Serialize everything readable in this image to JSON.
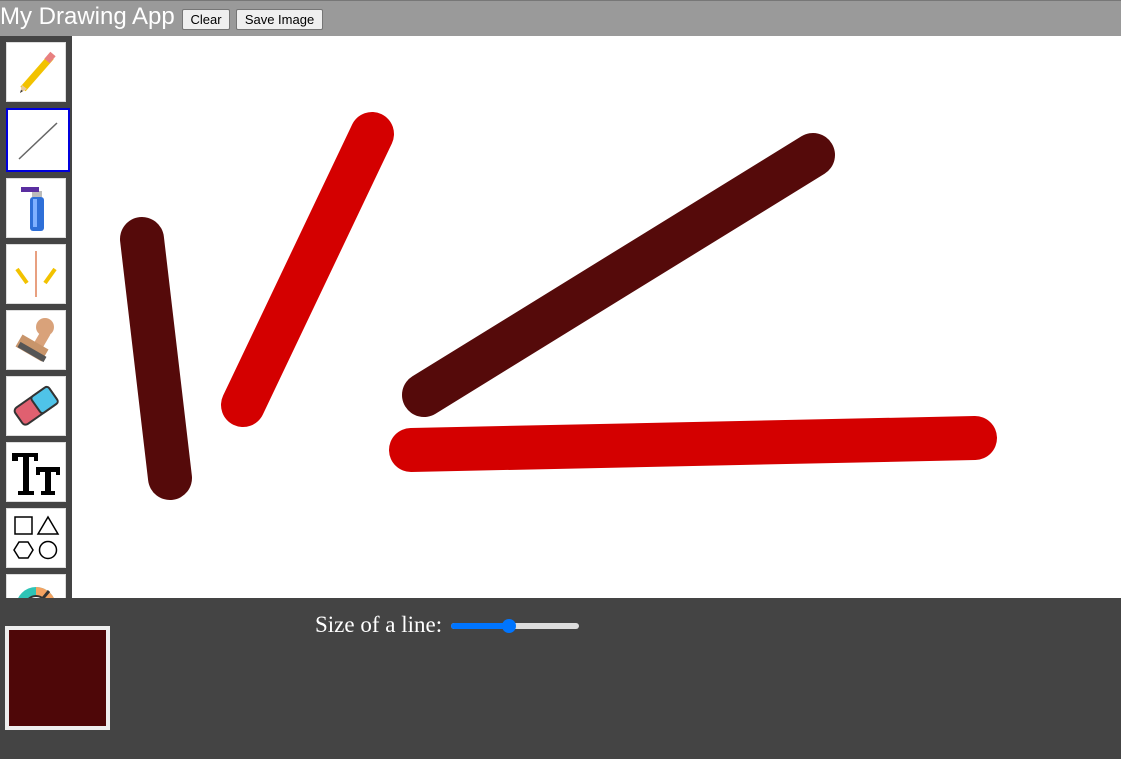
{
  "header": {
    "title": "My Drawing App",
    "clear_label": "Clear",
    "save_label": "Save Image"
  },
  "toolbar": {
    "tools": [
      {
        "name": "pencil",
        "icon": "pencil-icon",
        "active": false
      },
      {
        "name": "line",
        "icon": "line-icon",
        "active": true
      },
      {
        "name": "spray",
        "icon": "spray-can-icon",
        "active": false
      },
      {
        "name": "mirror",
        "icon": "mirror-pencils-icon",
        "active": false
      },
      {
        "name": "stamp",
        "icon": "stamp-icon",
        "active": false
      },
      {
        "name": "eraser",
        "icon": "eraser-icon",
        "active": false
      },
      {
        "name": "text",
        "icon": "text-icon",
        "active": false
      },
      {
        "name": "shapes",
        "icon": "shapes-icon",
        "active": false
      },
      {
        "name": "color-picker",
        "icon": "color-wheel-icon",
        "active": false
      }
    ]
  },
  "canvas": {
    "strokes": [
      {
        "color": "#550a0a"
      },
      {
        "color": "#d40000"
      },
      {
        "color": "#550a0a"
      },
      {
        "color": "#d40000"
      }
    ]
  },
  "controls": {
    "size_label": "Size of a line:",
    "size_value_fraction": 0.45,
    "current_color": "#4e0708"
  },
  "colors": {
    "header_bg": "#9a9a9a",
    "panel_bg": "#444444",
    "slider_accent": "#0075ff"
  }
}
